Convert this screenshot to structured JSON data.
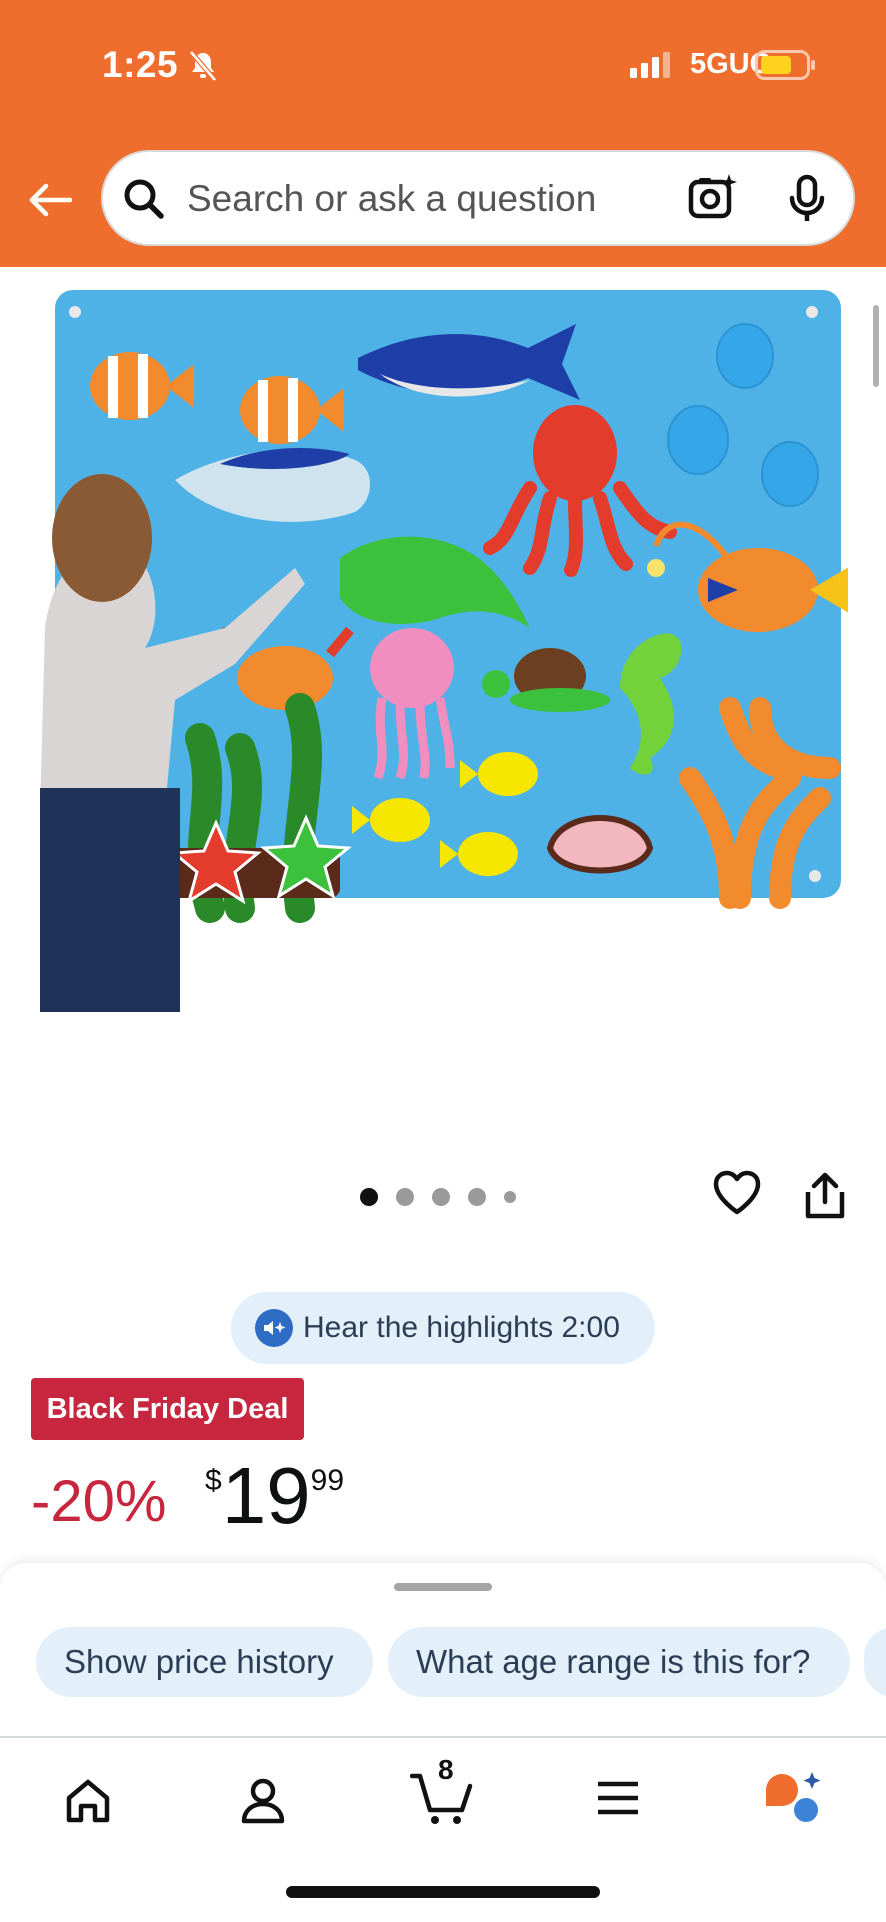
{
  "status_bar": {
    "time": "1:25",
    "network": "5GUC"
  },
  "search": {
    "placeholder": "Search or ask a question"
  },
  "product": {
    "image_alt": "Felt ocean animal board",
    "carousel_count": 5,
    "carousel_active": 1
  },
  "highlights": {
    "label": "Hear the highlights 2:00"
  },
  "deal": {
    "badge": "Black Friday Deal",
    "discount": "-20%",
    "price_symbol": "$",
    "price_whole": "19",
    "price_fraction": "99"
  },
  "suggestions": [
    "Show price history",
    "What age range is this for?"
  ],
  "tabbar": {
    "cart_count": "8",
    "items": [
      "home",
      "account",
      "cart",
      "menu",
      "rufus"
    ]
  },
  "colors": {
    "header": "#ef6e2d",
    "deal_red": "#c7263e",
    "chip_bg": "#e3f0fa"
  }
}
